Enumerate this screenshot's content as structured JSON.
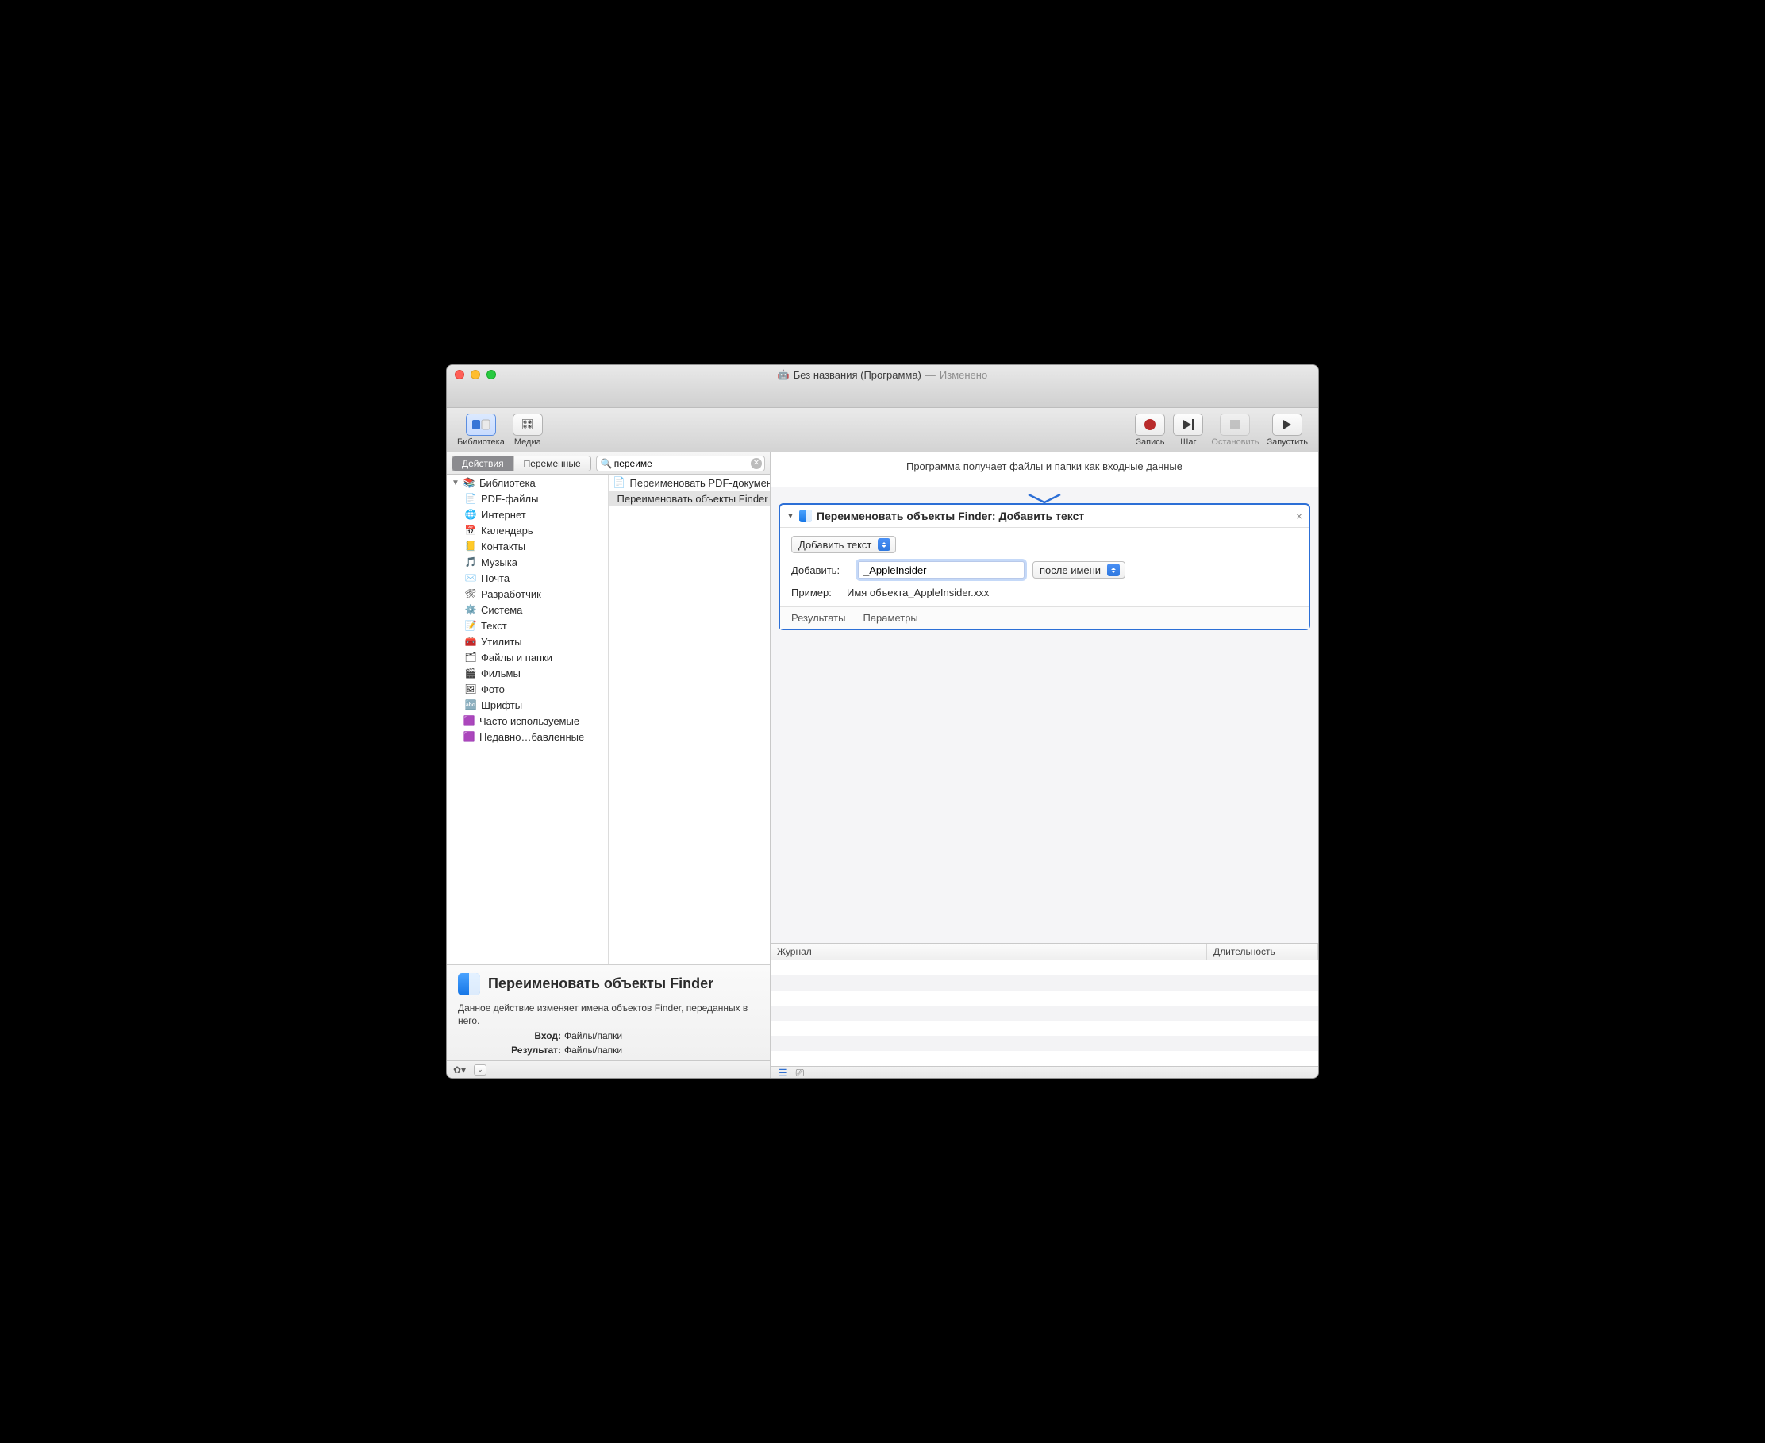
{
  "title": {
    "main": "Без названия (Программа)",
    "dash": "—",
    "state": "Изменено"
  },
  "toolbar": {
    "library": "Библиотека",
    "media": "Медиа",
    "record": "Запись",
    "step": "Шаг",
    "stop": "Остановить",
    "run": "Запустить"
  },
  "tabs": {
    "actions": "Действия",
    "variables": "Переменные"
  },
  "search": {
    "value": "переиме"
  },
  "library": {
    "root": "Библиотека",
    "items": [
      {
        "label": "PDF-файлы",
        "icon": "📄"
      },
      {
        "label": "Интернет",
        "icon": "🌐"
      },
      {
        "label": "Календарь",
        "icon": "📅"
      },
      {
        "label": "Контакты",
        "icon": "📒"
      },
      {
        "label": "Музыка",
        "icon": "🎵"
      },
      {
        "label": "Почта",
        "icon": "✉️"
      },
      {
        "label": "Разработчик",
        "icon": "🛠"
      },
      {
        "label": "Система",
        "icon": "⚙️"
      },
      {
        "label": "Текст",
        "icon": "📝"
      },
      {
        "label": "Утилиты",
        "icon": "🧰"
      },
      {
        "label": "Файлы и папки",
        "icon": "🗂"
      },
      {
        "label": "Фильмы",
        "icon": "🎬"
      },
      {
        "label": "Фото",
        "icon": "🖼"
      },
      {
        "label": "Шрифты",
        "icon": "🔤"
      }
    ],
    "smart": [
      {
        "label": "Часто используемые"
      },
      {
        "label": "Недавно…бавленные"
      }
    ]
  },
  "actions": [
    {
      "label": "Переименовать PDF-документы",
      "icon": "📄"
    },
    {
      "label": "Переименовать объекты Finder",
      "icon": "finder",
      "selected": true
    }
  ],
  "info": {
    "title": "Переименовать объекты Finder",
    "desc": "Данное действие изменяет имена объектов Finder, переданных в него.",
    "input_label": "Вход:",
    "input_value": "Файлы/папки",
    "output_label": "Результат:",
    "output_value": "Файлы/папки"
  },
  "workflow": {
    "header": "Программа получает файлы и папки как входные данные",
    "card": {
      "title": "Переименовать объекты Finder: Добавить текст",
      "mode": "Добавить текст",
      "add_label": "Добавить:",
      "add_value": "_AppleInsider",
      "position": "после имени",
      "example_label": "Пример:",
      "example_value": "Имя объекта_AppleInsider.xxx",
      "results": "Результаты",
      "params": "Параметры"
    }
  },
  "log": {
    "journal": "Журнал",
    "duration": "Длительность"
  }
}
